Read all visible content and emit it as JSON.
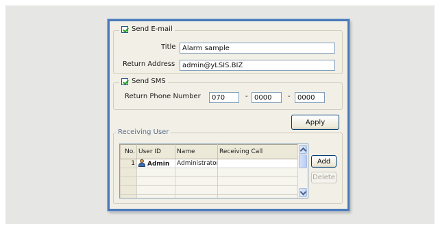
{
  "email": {
    "send_label": "Send E-mail",
    "send_checked": true,
    "title_label": "Title",
    "title_value": "Alarm sample",
    "return_label": "Return Address",
    "return_value": "admin@yLSIS.BIZ"
  },
  "sms": {
    "send_label": "Send SMS",
    "send_checked": true,
    "phone_label": "Return Phone Number",
    "phone_parts": [
      "070",
      "0000",
      "0000"
    ],
    "separator": "-"
  },
  "actions": {
    "apply_label": "Apply"
  },
  "receiving": {
    "legend": "Receiving User",
    "columns": [
      "No.",
      "User ID",
      "Name",
      "Receiving Call"
    ],
    "rows": [
      {
        "no": "1",
        "user_id": "Admin",
        "name": "Administrator",
        "receiving_call": ""
      }
    ],
    "add_label": "Add",
    "delete_label": "Delete",
    "delete_enabled": false
  }
}
